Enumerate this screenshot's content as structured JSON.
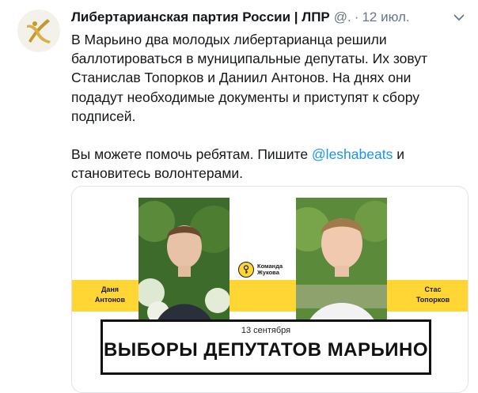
{
  "tweet": {
    "author": "Либертарианская партия России | ЛПР",
    "handle": "@.",
    "separator": "·",
    "date": "12 июл.",
    "paragraph1": "В Марьино два молодых либертарианца решили баллотироваться в муниципальные депутаты. Их зовут Станислав Топорков и Даниил Антонов. На днях они подадут необходимые документы и приступят к сбору подписей.",
    "paragraph2_before": "Вы можете помочь ребятам. Пишите ",
    "mention": "@leshabeats",
    "paragraph2_after": " и становитесь волонтерами."
  },
  "card": {
    "left_name_line1": "Даня",
    "left_name_line2": "Антонов",
    "right_name_line1": "Стас",
    "right_name_line2": "Топорков",
    "team_line1": "Команда",
    "team_line2": "Жукова",
    "banner_date": "13 сентября",
    "banner_title": "ВЫБОРЫ ДЕПУТАТОВ МАРЬИНО"
  },
  "icons": {
    "avatar": "party-logo-icon",
    "menu": "chevron-down-icon",
    "team": "key-icon"
  },
  "colors": {
    "accent_yellow": "#ffd633",
    "link_blue": "#1b95e0",
    "meta_gray": "#657786"
  }
}
